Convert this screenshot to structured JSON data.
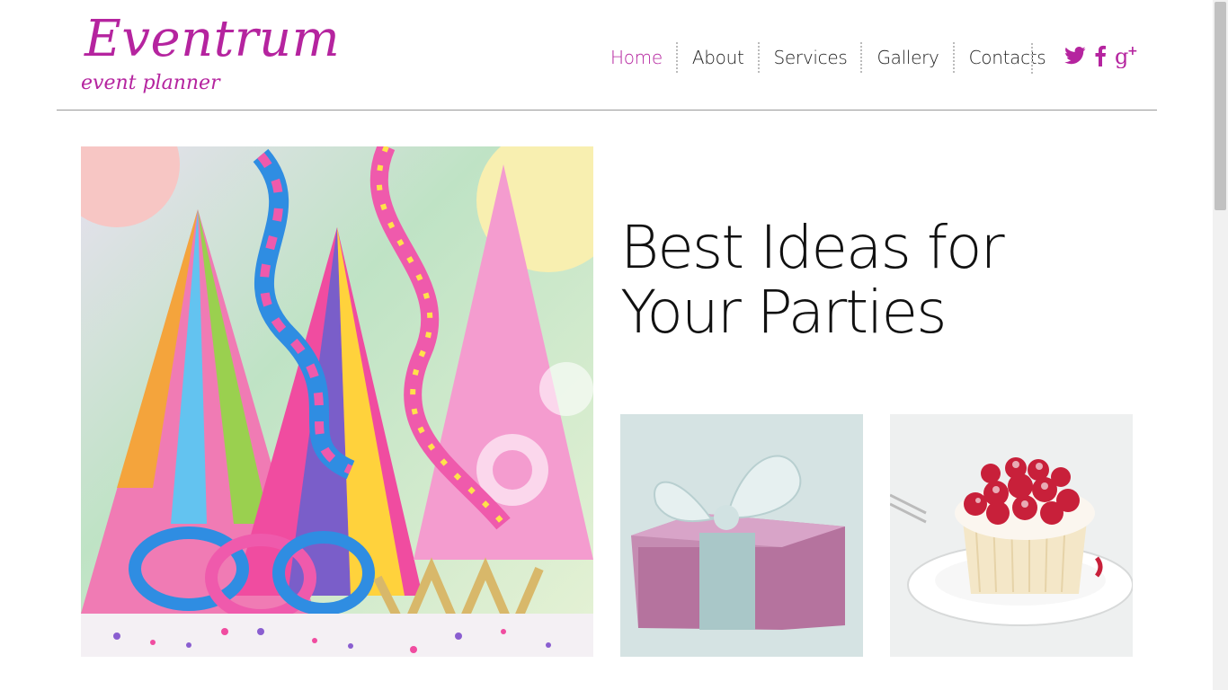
{
  "brand": {
    "name": "Eventrum",
    "tagline": "event planner",
    "accent_color": "#b5249f"
  },
  "nav": {
    "items": [
      {
        "label": "Home",
        "active": true
      },
      {
        "label": "About",
        "active": false
      },
      {
        "label": "Services",
        "active": false
      },
      {
        "label": "Gallery",
        "active": false
      },
      {
        "label": "Contacts",
        "active": false
      }
    ]
  },
  "social": {
    "icons": [
      "twitter-icon",
      "facebook-icon",
      "google-plus-icon"
    ]
  },
  "hero": {
    "headline_line1": "Best Ideas for",
    "headline_line2": "Your Parties"
  },
  "images": {
    "hero": "party-hats-streamers",
    "gift": "gift-box",
    "cake": "raspberry-cake"
  }
}
